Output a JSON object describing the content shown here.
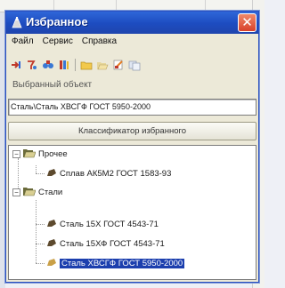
{
  "window": {
    "title": "Избранное",
    "close_symbol": "✕"
  },
  "menu": [
    "Файл",
    "Сервис",
    "Справка"
  ],
  "toolbar": {
    "icons": [
      "import-icon",
      "filter-icon",
      "binoculars-icon",
      "books-icon",
      "folder-icon",
      "folder-open-icon",
      "edit-icon",
      "copy-icon"
    ]
  },
  "selected_object": {
    "label": "Выбранный объект",
    "value": "Сталь\\Сталь ХВСГФ ГОСТ 5950-2000"
  },
  "classifier_button": "Классификатор избранного",
  "tree": {
    "group1": {
      "toggle": "−",
      "label": "Прочее",
      "children": [
        "Сплав АК5М2 ГОСТ 1583-93"
      ]
    },
    "group2": {
      "toggle": "−",
      "label": "Стали",
      "children": [
        "Сталь 15Х ГОСТ 4543-71",
        "Сталь 15ХФ ГОСТ 4543-71",
        "Сталь ХВСГФ ГОСТ 5950-2000"
      ]
    }
  },
  "colors": {
    "titlebar": "#2f66d8",
    "selection": "#1c3fae",
    "close": "#d8412a"
  }
}
